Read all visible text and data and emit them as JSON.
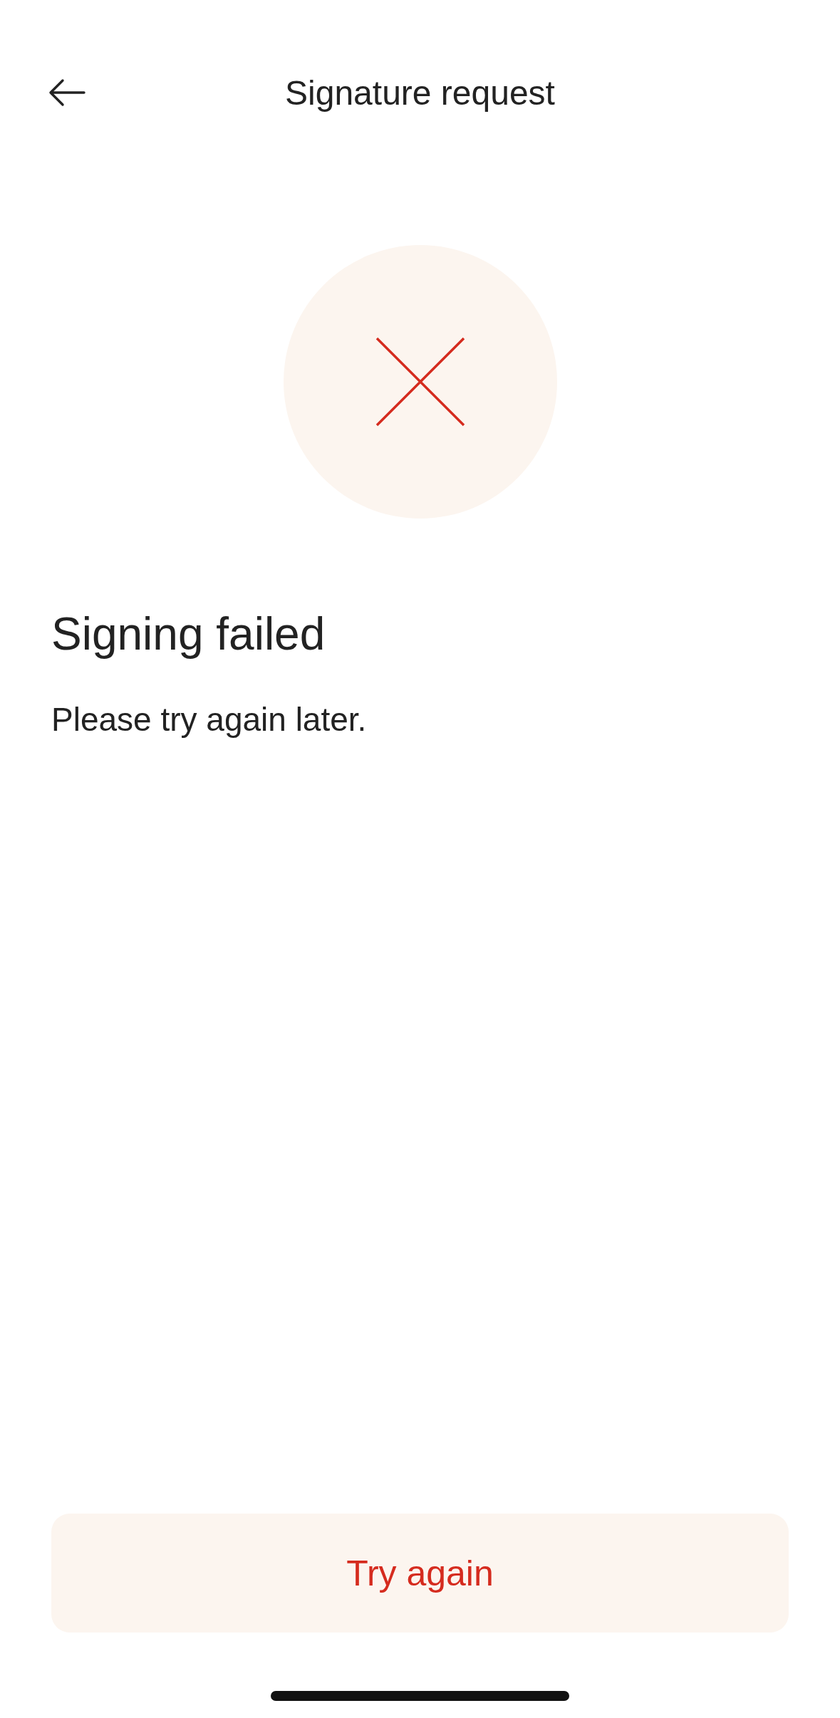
{
  "header": {
    "title": "Signature request"
  },
  "status": {
    "kind": "error",
    "title": "Signing failed",
    "message": "Please try again later."
  },
  "buttons": [
    {
      "label": "Try again"
    }
  ]
}
